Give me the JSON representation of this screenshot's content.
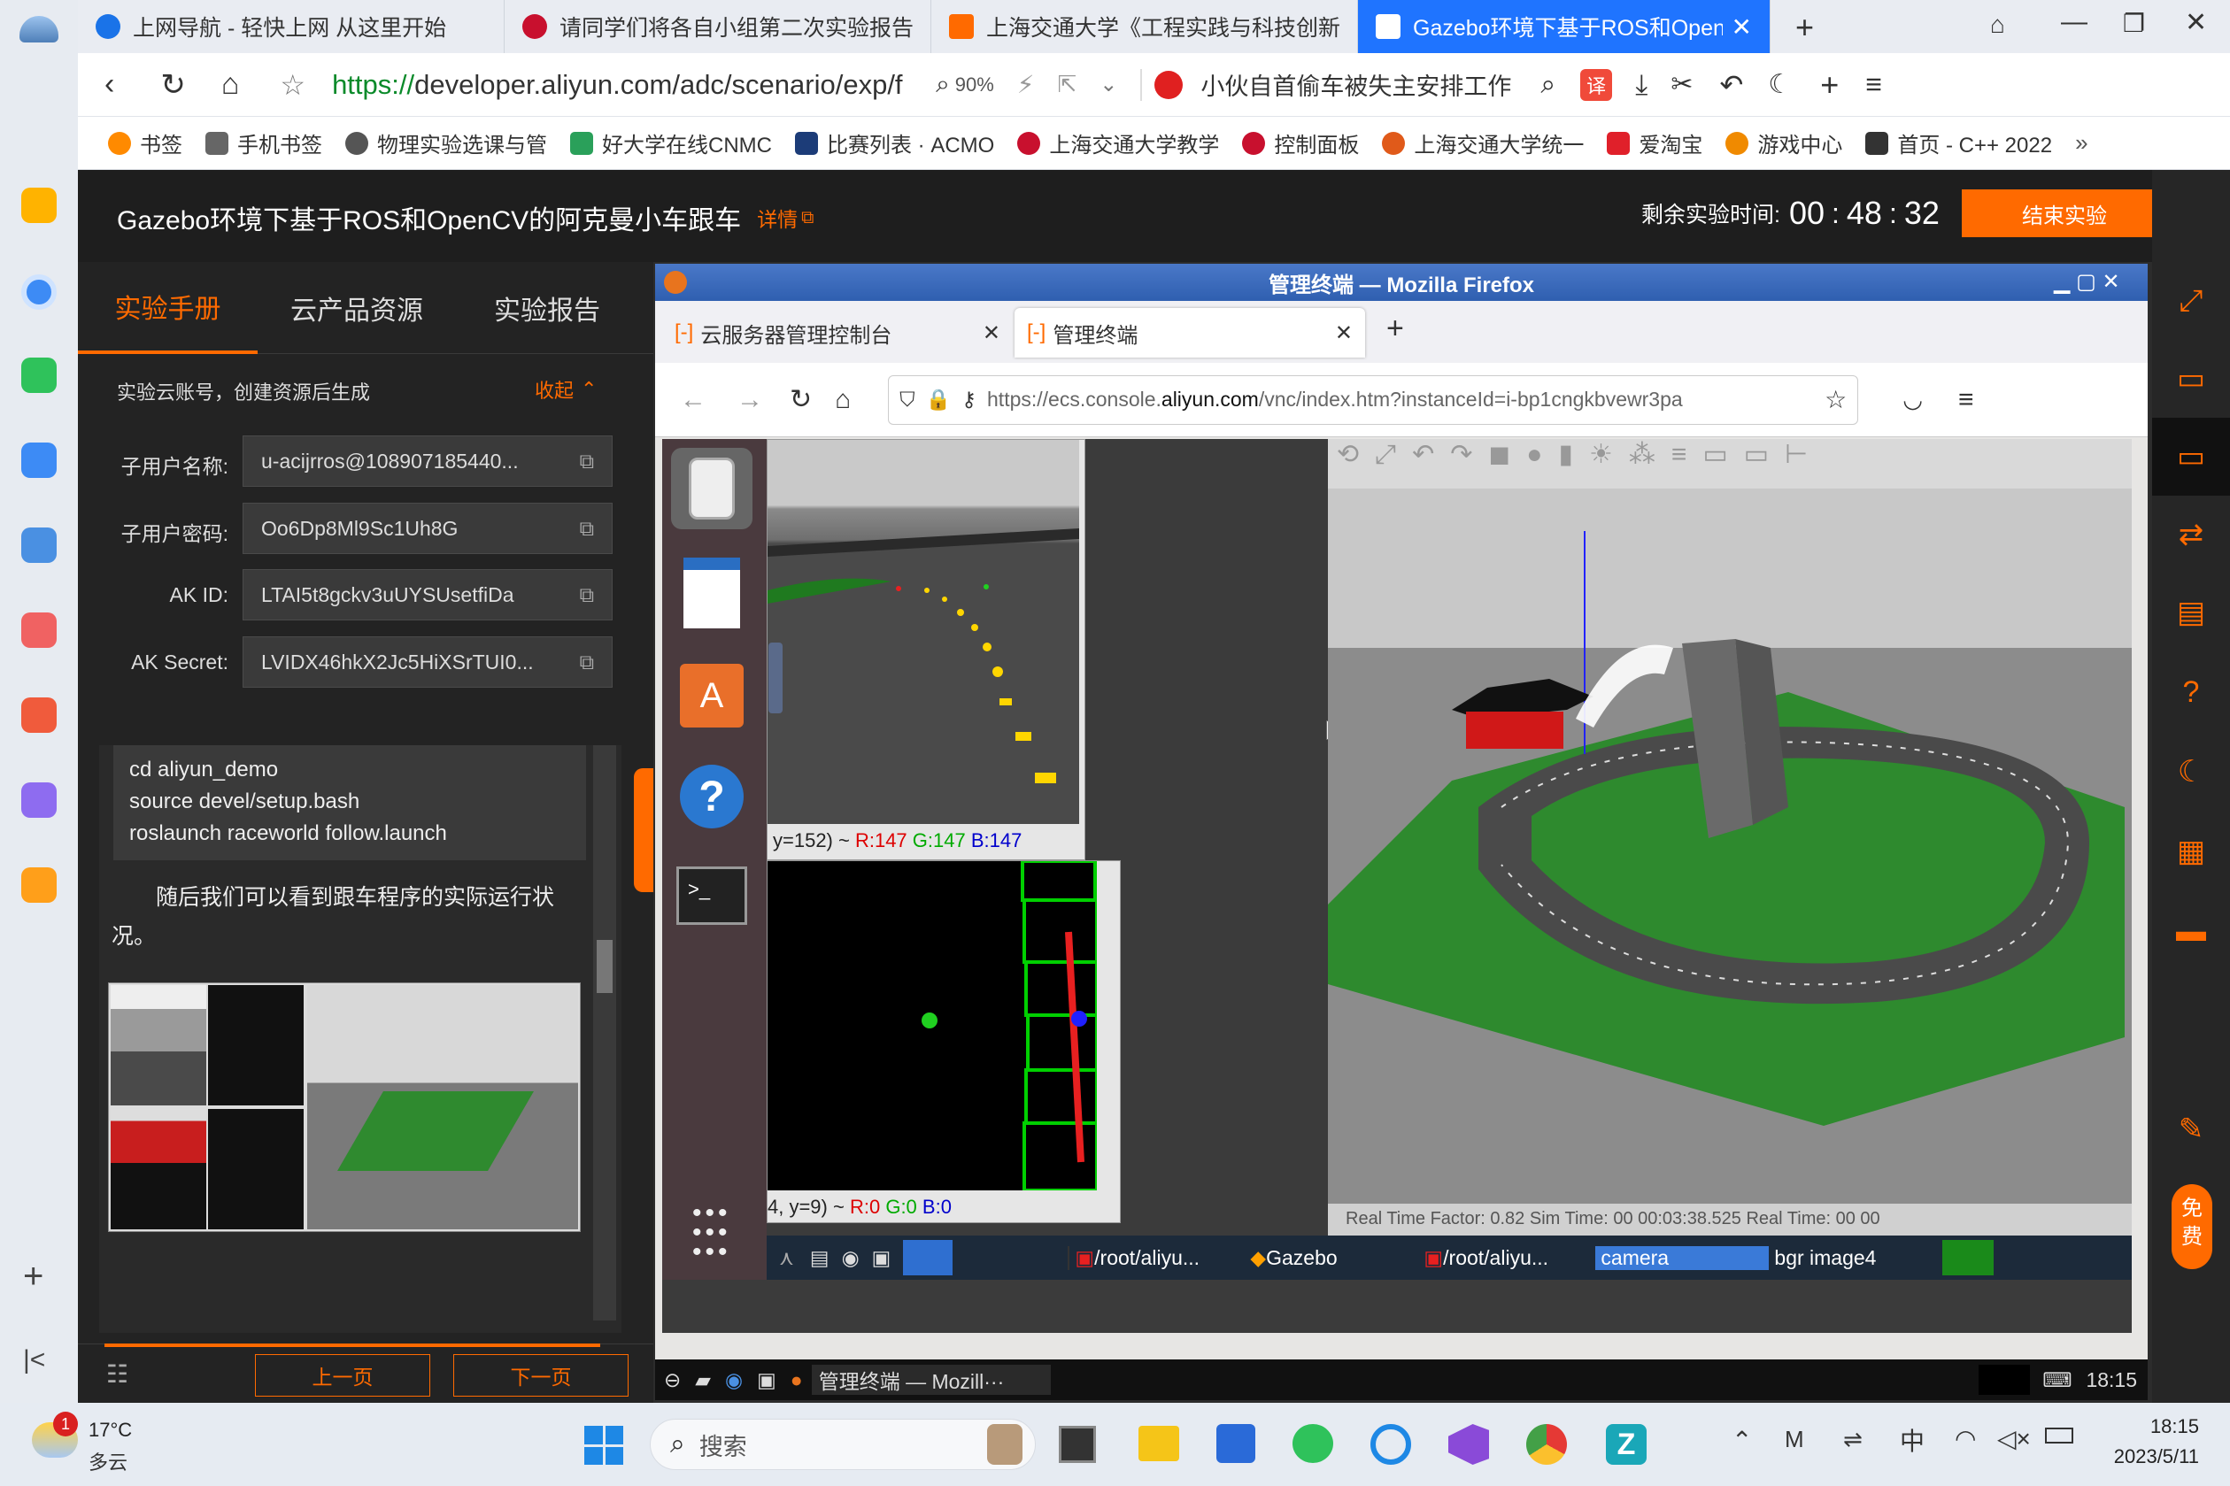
{
  "browser": {
    "tabs": [
      {
        "label": "上网导航 - 轻快上网 从这里开始",
        "color": "#1a73e8"
      },
      {
        "label": "请同学们将各自小组第二次实验报告",
        "color": "#c8102e"
      },
      {
        "label": "上海交通大学《工程实践与科技创新",
        "color": "#ff6a00"
      },
      {
        "label": "Gazebo环境下基于ROS和OpenCV",
        "color": "#ffffff"
      }
    ],
    "url_scheme": "https://",
    "url_rest": "developer.aliyun.com/adc/scenario/exp/f",
    "zoom": "90%",
    "search_text": "小伙自首偷车被失主安排工作",
    "bookmarks": [
      {
        "label": "书签",
        "color": "#ff8a00"
      },
      {
        "label": "手机书签",
        "color": "#555555"
      },
      {
        "label": "物理实验选课与管",
        "color": "#555555"
      },
      {
        "label": "好大学在线CNMC",
        "color": "#2aa05a"
      },
      {
        "label": "比赛列表 · ACMO",
        "color": "#1c3c78"
      },
      {
        "label": "上海交通大学教学",
        "color": "#c8102e"
      },
      {
        "label": "控制面板",
        "color": "#c8102e"
      },
      {
        "label": "上海交通大学统一",
        "color": "#e05a1a"
      },
      {
        "label": "爱淘宝",
        "color": "#e0202a"
      },
      {
        "label": "游戏中心",
        "color": "#f08a00"
      },
      {
        "label": "首页 - C++ 2022",
        "color": "#333333"
      }
    ]
  },
  "page": {
    "title": "Gazebo环境下基于ROS和OpenCV的阿克曼小车跟车",
    "details_link": "详情",
    "timer_label": "剩余实验时间:",
    "timer_h": "00",
    "timer_m": "48",
    "timer_s": "32",
    "end_button": "结束实验",
    "panel_tabs": [
      "实验手册",
      "云产品资源",
      "实验报告"
    ],
    "account_title": "实验云账号，创建资源后生成",
    "collapse_label": "收起",
    "fields": [
      {
        "label": "子用户名称:",
        "value": "u-acijrros@108907185440..."
      },
      {
        "label": "子用户密码:",
        "value": "Oo6Dp8Ml9Sc1Uh8G"
      },
      {
        "label": "AK ID:",
        "value": "LTAI5t8gckv3uUYSUsetfiDa"
      },
      {
        "label": "AK Secret:",
        "value": "LVIDX46hkX2Jc5HiXSrTUI0..."
      }
    ],
    "code_lines": [
      "cd aliyun_demo",
      "source devel/setup.bash",
      "roslaunch raceworld follow.launch"
    ],
    "body_text": "随后我们可以看到跟车程序的实际运行状况。",
    "prev_button": "上一页",
    "next_button": "下一页"
  },
  "firefox": {
    "title": "管理终端 — Mozilla Firefox",
    "tabs": [
      "云服务器管理控制台",
      "管理终端"
    ],
    "url_prefix": "https://ecs.console.",
    "url_domain": "aliyun.com",
    "url_rest": "/vnc/index.htm?instanceId=i-bp1cngkbvewr3pa"
  },
  "ubuntu": {
    "camera_status_prefix": "y=152) ~ ",
    "camera_r": "R:147",
    "camera_g": "G:147",
    "camera_b": "B:147",
    "bgr_status_prefix": "4, y=9) ~ ",
    "bgr_r": "R:0",
    "bgr_g": "G:0",
    "bgr_b": "B:0",
    "gazebo_status": "Real Time Factor: 0.82   Sim Time: 00 00:03:38.525   Real Time: 00 00",
    "taskbar_items": [
      "/root/aliyu...",
      "Gazebo",
      "/root/aliyu...",
      "camera",
      "bgr image4"
    ],
    "outer_task": "管理终端 — Mozill···",
    "outer_clock": "18:15"
  },
  "windows": {
    "weather_temp": "17°C",
    "weather_desc": "多云",
    "weather_badge": "1",
    "search_placeholder": "搜索",
    "ime": "中",
    "time": "18:15",
    "date": "2023/5/11"
  },
  "colors": {
    "accent": "#ff6a00",
    "browser_blue": "#1f74ff",
    "url_green": "#0a8a2a"
  }
}
